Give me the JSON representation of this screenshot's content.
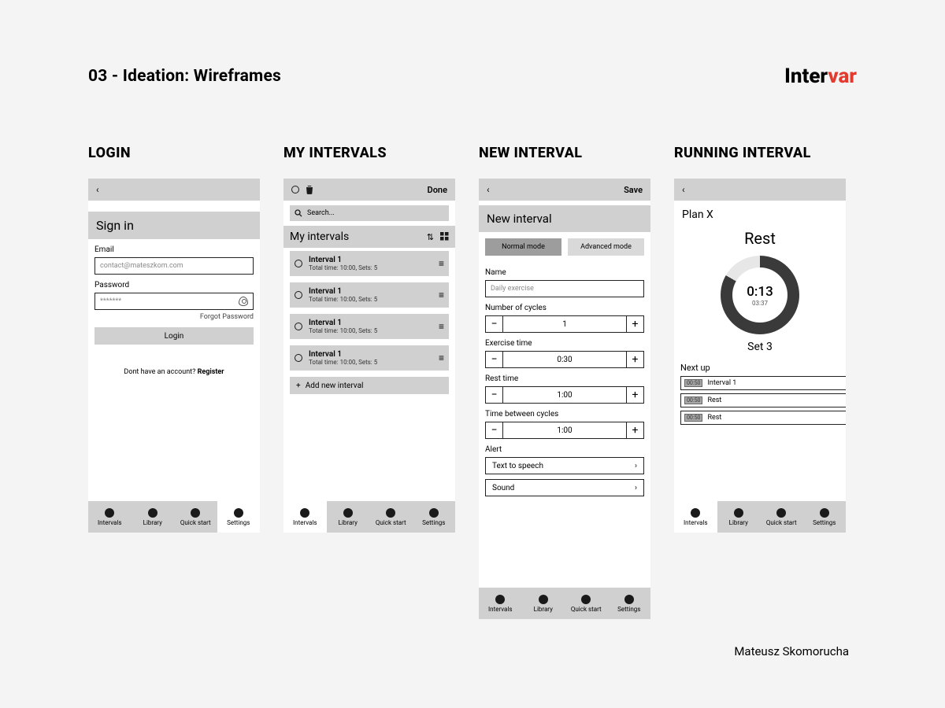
{
  "page_title": "03 - Ideation: Wireframes",
  "brand_left": "Inter",
  "brand_right": "var",
  "author": "Mateusz Skomorucha",
  "tabs": [
    "Intervals",
    "Library",
    "Quick start",
    "Settings"
  ],
  "login": {
    "board_title": "LOGIN",
    "signin": "Sign in",
    "email_label": "Email",
    "email_placeholder": "contact@mateszkom.com",
    "password_label": "Password",
    "password_placeholder": "*******",
    "forgot": "Forgot Password",
    "login_btn": "Login",
    "register_q": "Dont have an account? ",
    "register": "Register"
  },
  "myintervals": {
    "board_title": "MY INTERVALS",
    "done": "Done",
    "search_placeholder": "Search...",
    "header": "My intervals",
    "item_title": "Interval 1",
    "item_sub": "Total time: 10:00, Sets: 5",
    "add": "Add new interval"
  },
  "newinterval": {
    "board_title": "NEW INTERVAL",
    "save": "Save",
    "header": "New interval",
    "mode_normal": "Normal mode",
    "mode_advanced": "Advanced mode",
    "name_label": "Name",
    "name_placeholder": "Daily exercise",
    "cycles_label": "Number of cycles",
    "cycles_value": "1",
    "exercise_label": "Exercise time",
    "exercise_value": "0:30",
    "rest_label": "Rest time",
    "rest_value": "1:00",
    "between_label": "Time between cycles",
    "between_value": "1:00",
    "alert_label": "Alert",
    "alert_tts": "Text to speech",
    "alert_sound": "Sound"
  },
  "running": {
    "board_title": "RUNNING INTERVAL",
    "plan": "Plan X",
    "phase": "Rest",
    "time": "0:13",
    "total": "03:37",
    "set": "Set 3",
    "nextup": "Next up",
    "next_tag": "00:50",
    "next1": "Interval 1",
    "next2": "Rest",
    "next3": "Rest"
  }
}
